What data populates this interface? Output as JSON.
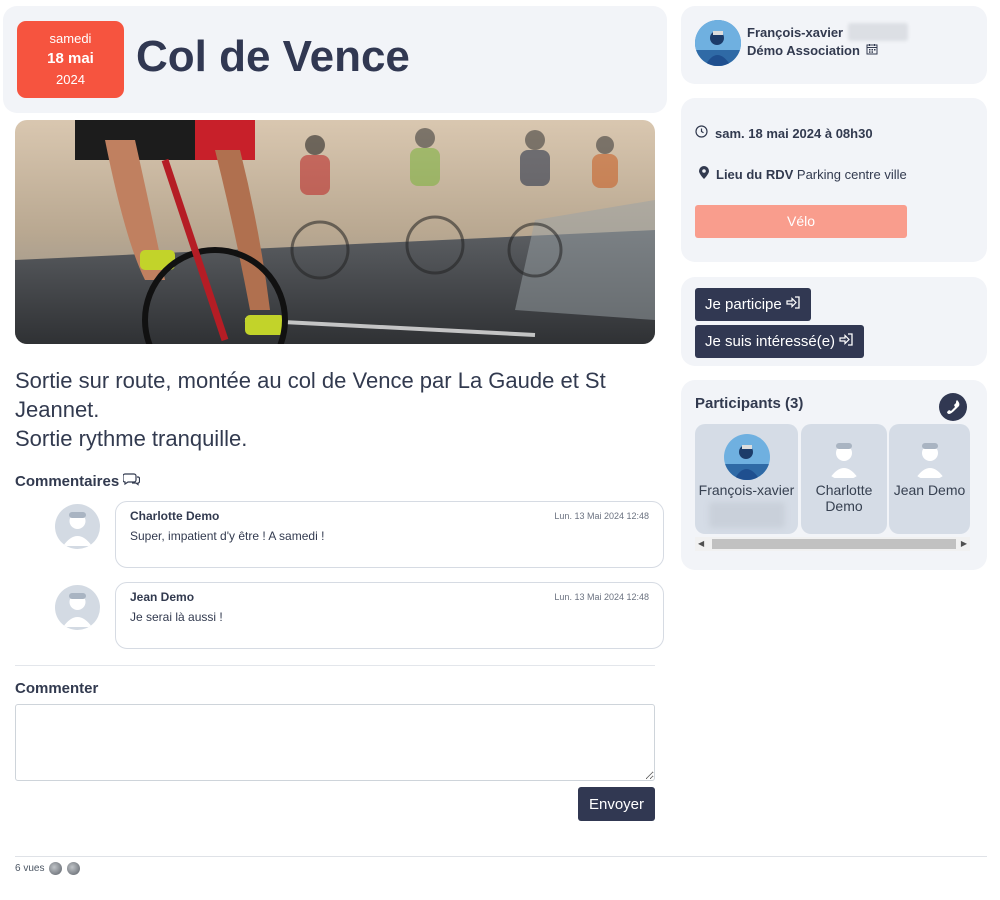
{
  "event": {
    "date_day_name": "samedi",
    "date_day": "18 mai",
    "date_year": "2024",
    "title": "Col de Vence",
    "description_line1": "Sortie sur route, montée au col de Vence par La Gaude et St Jeannet.",
    "description_line2": "Sortie rythme tranquille."
  },
  "comments": {
    "title": "Commentaires",
    "items": [
      {
        "author": "Charlotte Demo",
        "timestamp": "Lun. 13 Mai 2024 12:48",
        "text": "Super, impatient d'y être ! A samedi !"
      },
      {
        "author": "Jean Demo",
        "timestamp": "Lun. 13 Mai 2024 12:48",
        "text": "Je serai là aussi !"
      }
    ],
    "form_label": "Commenter",
    "send_label": "Envoyer"
  },
  "footer": {
    "views": "6 vues"
  },
  "organizer": {
    "name": "François-xavier",
    "association": "Démo Association"
  },
  "infos": {
    "datetime": "sam. 18 mai 2024 à 08h30",
    "meeting_label": "Lieu du RDV",
    "meeting_place": "Parking centre ville",
    "category": "Vélo"
  },
  "actions": {
    "participate": "Je participe",
    "interested": "Je suis intéressé(e)"
  },
  "participants": {
    "title": "Participants (3)",
    "list": [
      {
        "name": "François-xavier"
      },
      {
        "name": "Charlotte Demo"
      },
      {
        "name": "Jean Demo"
      }
    ]
  },
  "colors": {
    "accent": "#f6543f",
    "dark": "#313852",
    "tag": "#f99d8d",
    "panel": "#f2f4f8"
  }
}
